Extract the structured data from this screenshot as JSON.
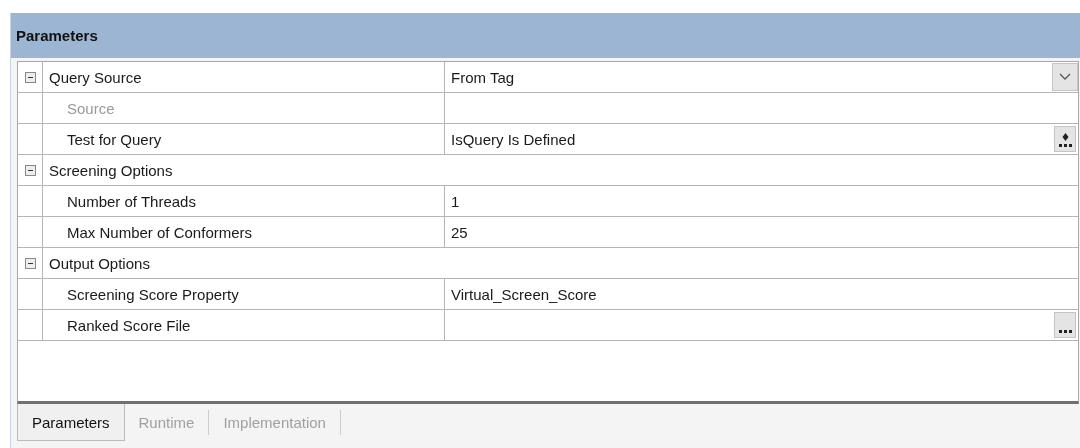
{
  "panel": {
    "title": "Parameters"
  },
  "groups": [
    {
      "label": "Query Source",
      "value": "From Tag",
      "kind": "dropdown",
      "expanded": true,
      "children": [
        {
          "label": "Source",
          "disabled": true
        },
        {
          "label": "Test for Query",
          "value": "IsQuery Is Defined",
          "kind": "picker",
          "disabled": false
        }
      ]
    },
    {
      "label": "Screening Options",
      "expanded": true,
      "children": [
        {
          "label": "Number of Threads",
          "value": "1",
          "disabled": false
        },
        {
          "label": "Max Number of Conformers",
          "value": "25",
          "disabled": false
        }
      ]
    },
    {
      "label": "Output Options",
      "expanded": true,
      "children": [
        {
          "label": "Screening Score Property",
          "value": "Virtual_Screen_Score",
          "disabled": false
        },
        {
          "label": "Ranked Score File",
          "kind": "browse",
          "disabled": false
        }
      ]
    }
  ],
  "tabs": [
    {
      "label": "Parameters",
      "selected": true
    },
    {
      "label": "Runtime",
      "selected": false
    },
    {
      "label": "Implementation",
      "selected": false
    }
  ]
}
